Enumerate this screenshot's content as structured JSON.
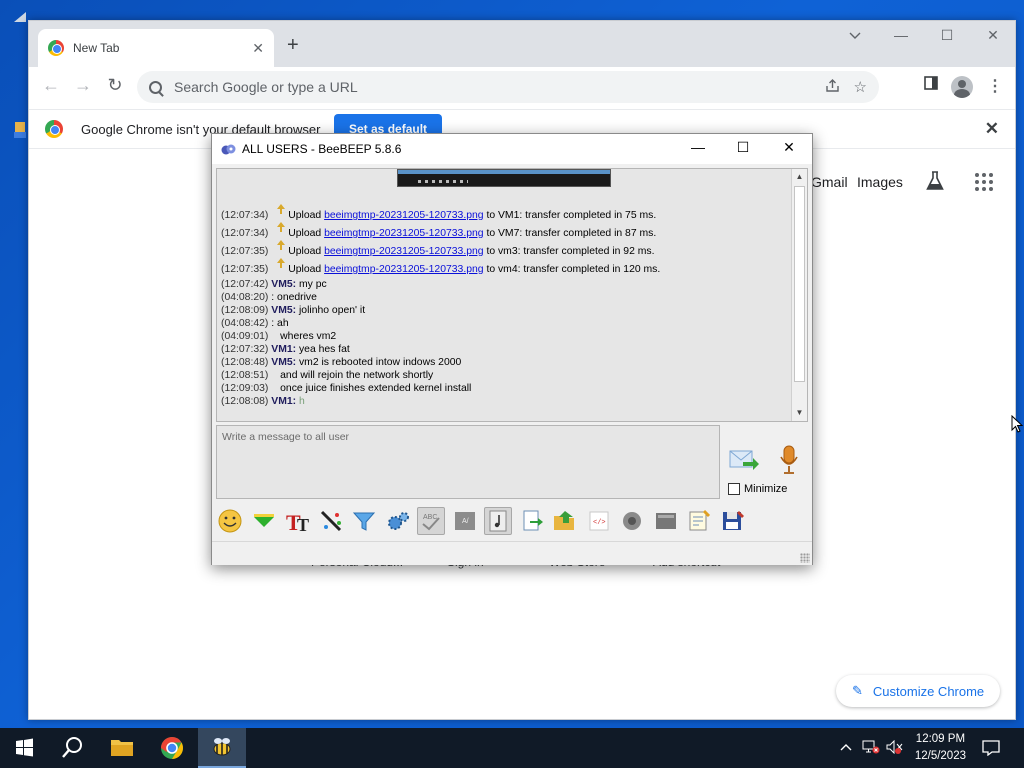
{
  "browser": {
    "tab_title": "New Tab",
    "omnibox_placeholder": "Search Google or type a URL",
    "infobar": {
      "message": "Google Chrome isn't your default browser",
      "button": "Set as default"
    },
    "ntp_links": {
      "gmail": "Gmail",
      "images": "Images"
    },
    "shortcut_labels": [
      "Personal Cloud...",
      "Sign in",
      "Web Store",
      "Add shortcut"
    ],
    "customize_label": "Customize Chrome"
  },
  "beebeep": {
    "title": "ALL USERS - BeeBEEP 5.8.6",
    "messages": [
      {
        "time": "(12:07:34)",
        "prefix": "Upload",
        "file": "beeimgtmp-20231205-120733.png",
        "suffix": "to VM1: transfer completed in 75 ms."
      },
      {
        "time": "(12:07:34)",
        "prefix": "Upload",
        "file": "beeimgtmp-20231205-120733.png",
        "suffix": "to VM7: transfer completed in 87 ms."
      },
      {
        "time": "(12:07:35)",
        "prefix": "Upload",
        "file": "beeimgtmp-20231205-120733.png",
        "suffix": "to vm3: transfer completed in 92 ms."
      },
      {
        "time": "(12:07:35)",
        "prefix": "Upload",
        "file": "beeimgtmp-20231205-120733.png",
        "suffix": "to vm4: transfer completed in 120 ms."
      }
    ],
    "chat": [
      {
        "time": "(12:07:42)",
        "sender": "VM5:",
        "text": "my pc"
      },
      {
        "time": "(04:08:20)",
        "sender": "",
        "text": ": onedrive"
      },
      {
        "time": "(12:08:09)",
        "sender": "VM5:",
        "text": "jolinho open' it"
      },
      {
        "time": "(04:08:42)",
        "sender": "",
        "text": ": ah"
      },
      {
        "time": "(04:09:01)",
        "sender": "",
        "text": "wheres vm2"
      },
      {
        "time": "(12:07:32)",
        "sender": "VM1:",
        "text": "yea hes fat"
      },
      {
        "time": "(12:08:48)",
        "sender": "VM5:",
        "text": "vm2 is rebooted intow indows 2000"
      },
      {
        "time": "(12:08:51)",
        "sender": "",
        "text": "and will rejoin the network shortly"
      },
      {
        "time": "(12:09:03)",
        "sender": "",
        "text": "once juice finishes extended kernel install"
      },
      {
        "time": "(12:08:08)",
        "sender": "VM1:",
        "text": "h"
      }
    ],
    "compose_placeholder": "Write a message to all user",
    "minimize_label": "Minimize"
  },
  "taskbar": {
    "time": "12:09 PM",
    "date": "12/5/2023"
  }
}
